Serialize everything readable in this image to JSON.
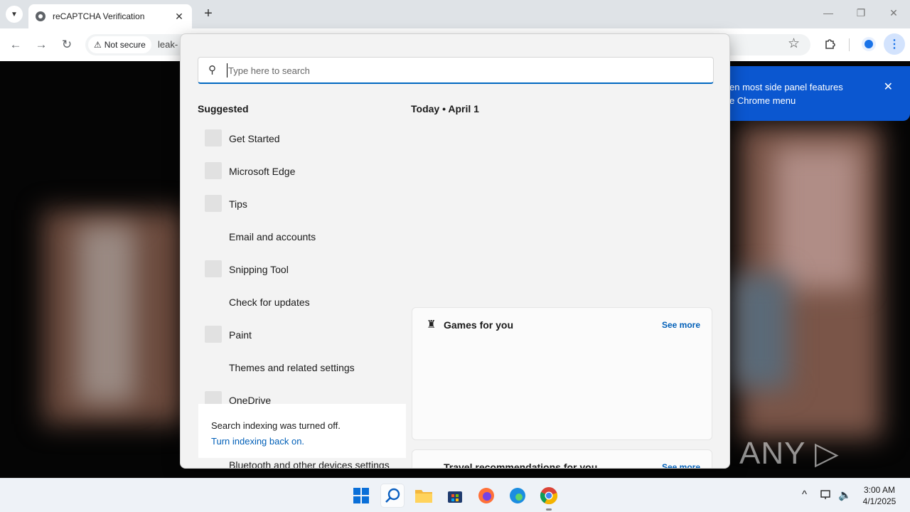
{
  "browser": {
    "tab": {
      "title": "reCAPTCHA Verification",
      "close": "✕"
    },
    "new_tab": "+",
    "window_controls": {
      "minimize": "—",
      "restore": "❐",
      "close": "✕"
    },
    "nav": {
      "back": "←",
      "forward": "→",
      "reload": "↻"
    },
    "security_chip": {
      "icon": "⚠",
      "label": "Not secure"
    },
    "url": "leak-",
    "star": "☆",
    "menu": "⋮",
    "promo_bubble": {
      "line1": "en most side panel features",
      "line2": "e Chrome menu",
      "close": "✕"
    }
  },
  "search": {
    "placeholder": "Type here to search",
    "icon": "⚲",
    "suggested_title": "Suggested",
    "suggested": [
      {
        "label": "Get Started",
        "icon": true
      },
      {
        "label": "Microsoft Edge",
        "icon": true
      },
      {
        "label": "Tips",
        "icon": true
      },
      {
        "label": "Email and accounts",
        "icon": false
      },
      {
        "label": "Snipping Tool",
        "icon": true
      },
      {
        "label": "Check for updates",
        "icon": false
      },
      {
        "label": "Paint",
        "icon": true
      },
      {
        "label": "Themes and related settings",
        "icon": false
      },
      {
        "label": "OneDrive",
        "icon": true
      }
    ],
    "bottom_item": "Bluetooth and other devices settings",
    "today_label": "Today  •  April 1",
    "cards": {
      "games": {
        "title": "Games for you",
        "see_more": "See more",
        "icon": "♜"
      },
      "travel": {
        "title": "Travel recommendations for you",
        "see_more": "See more"
      }
    },
    "indexing": {
      "message": "Search indexing was turned off.",
      "link": "Turn indexing back on."
    }
  },
  "watermark": "ANY ▷ RUN",
  "taskbar": {
    "clock_time": "3:00 AM",
    "clock_date": "4/1/2025",
    "tray_chevron": "^",
    "tray_speaker": "🔈"
  }
}
